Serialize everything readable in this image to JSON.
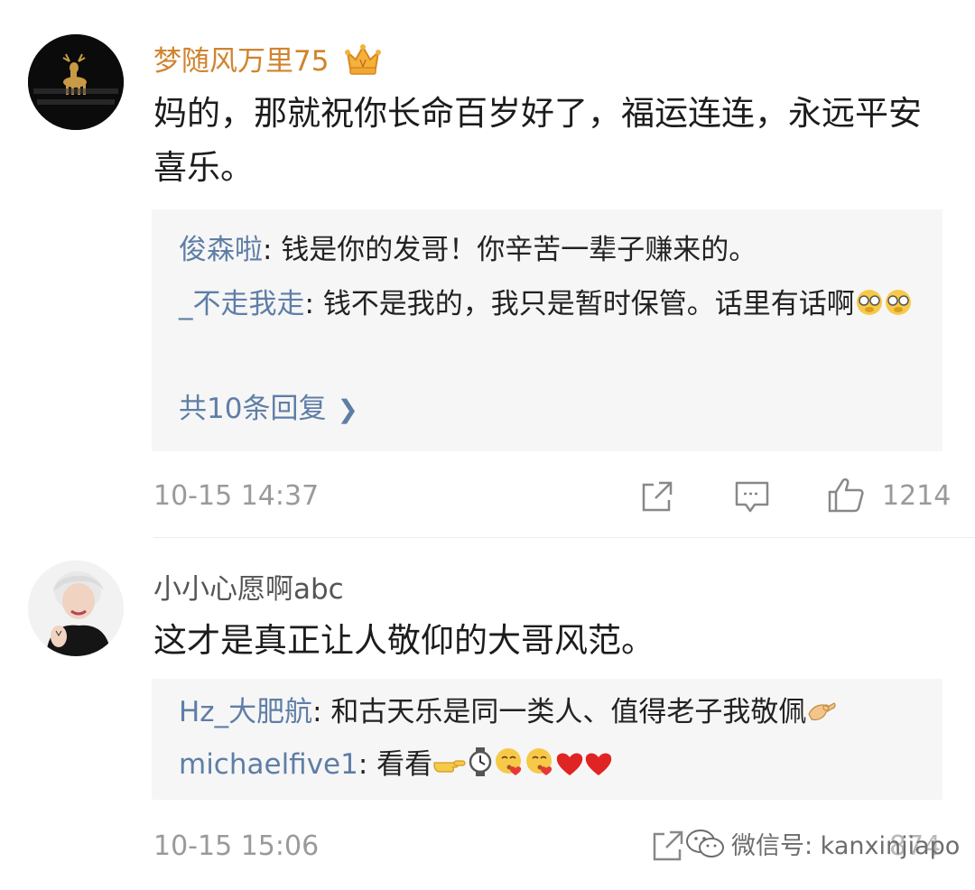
{
  "comments": [
    {
      "username": "梦随风万里75",
      "text": "妈的，那就祝你长命百岁好了，福运连连，永远平安喜乐。",
      "replies": [
        {
          "name": "俊森啦",
          "sep": ": ",
          "text": "钱是你的发哥！你辛苦一辈子赚来的。"
        },
        {
          "name": "_不走我走",
          "sep": ": ",
          "text": "钱不是我的，我只是暂时保管。话里有话啊"
        }
      ],
      "more_replies": "共10条回复",
      "time": "10-15 14:37",
      "likes": "1214"
    },
    {
      "username": "小小心愿啊abc",
      "text": "这才是真正让人敬仰的大哥风范。",
      "replies": [
        {
          "name": "Hz_大肥航",
          "sep": ": ",
          "text": "和古天乐是同一类人、值得老子我敬佩"
        },
        {
          "name": "michaelfive1",
          "sep": ": ",
          "text": "看看"
        }
      ],
      "time": "10-15 15:06",
      "likes": "874"
    }
  ],
  "watermark": "微信号: kanxinjiapo",
  "icons": {
    "repost": "share-icon",
    "comment": "comment-icon",
    "like": "thumbs-up-icon",
    "vip": "crown-icon"
  },
  "colors": {
    "vip_name": "#d0832d",
    "reply_name": "#5f7ea6",
    "meta": "#9a9a9a",
    "reply_bg": "#f6f6f6"
  }
}
